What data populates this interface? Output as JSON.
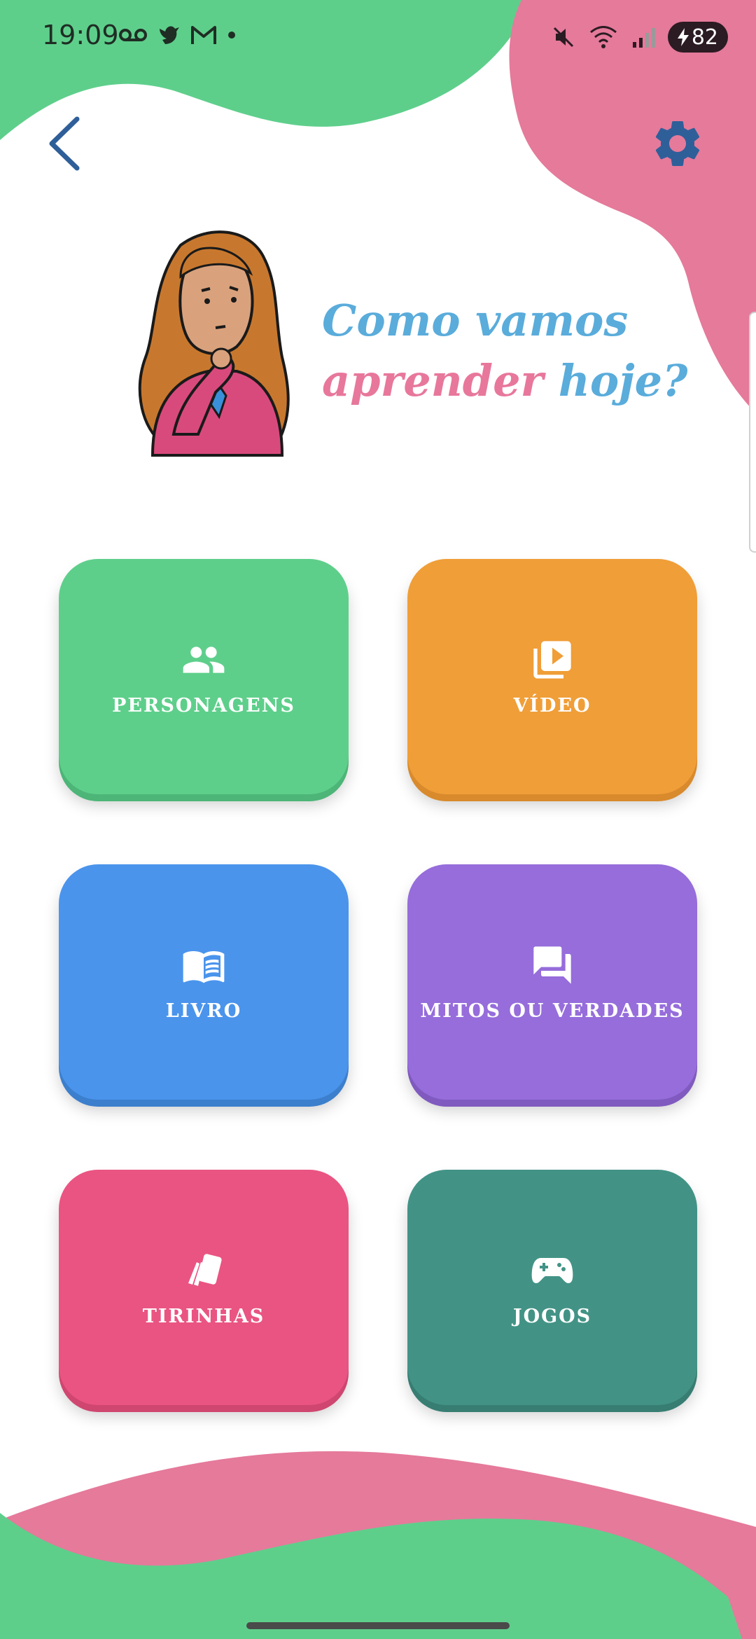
{
  "status_bar": {
    "time": "19:09",
    "battery_level": "82",
    "icons_left": [
      "voicemail-icon",
      "bird-icon",
      "gmail-icon",
      "dot-icon"
    ],
    "icons_right": [
      "mute-icon",
      "wifi-icon",
      "signal-icon",
      "battery-icon"
    ]
  },
  "header": {
    "back_icon": "chevron-left-icon",
    "settings_icon": "gear-icon"
  },
  "hero": {
    "line1": "Como vamos",
    "line2_pink": "aprender",
    "line2_blue": "hoje?"
  },
  "tiles": [
    {
      "label": "PERSONAGENS",
      "icon": "people-icon",
      "color": "#5ecf8b"
    },
    {
      "label": "VÍDEO",
      "icon": "video-library-icon",
      "color": "#f09e38"
    },
    {
      "label": "LIVRO",
      "icon": "open-book-icon",
      "color": "#4a94ec"
    },
    {
      "label": "MITOS OU VERDADES",
      "icon": "forum-icon",
      "color": "#966ddb"
    },
    {
      "label": "TIRINHAS",
      "icon": "cards-icon",
      "color": "#ea5482"
    },
    {
      "label": "JOGOS",
      "icon": "gamepad-icon",
      "color": "#429386"
    }
  ],
  "colors": {
    "green_blob": "#5ecf8b",
    "pink_blob": "#e57a9b",
    "icon_blue": "#2f5f99",
    "headline_blue": "#5aacdb",
    "headline_pink": "#e8779c"
  }
}
